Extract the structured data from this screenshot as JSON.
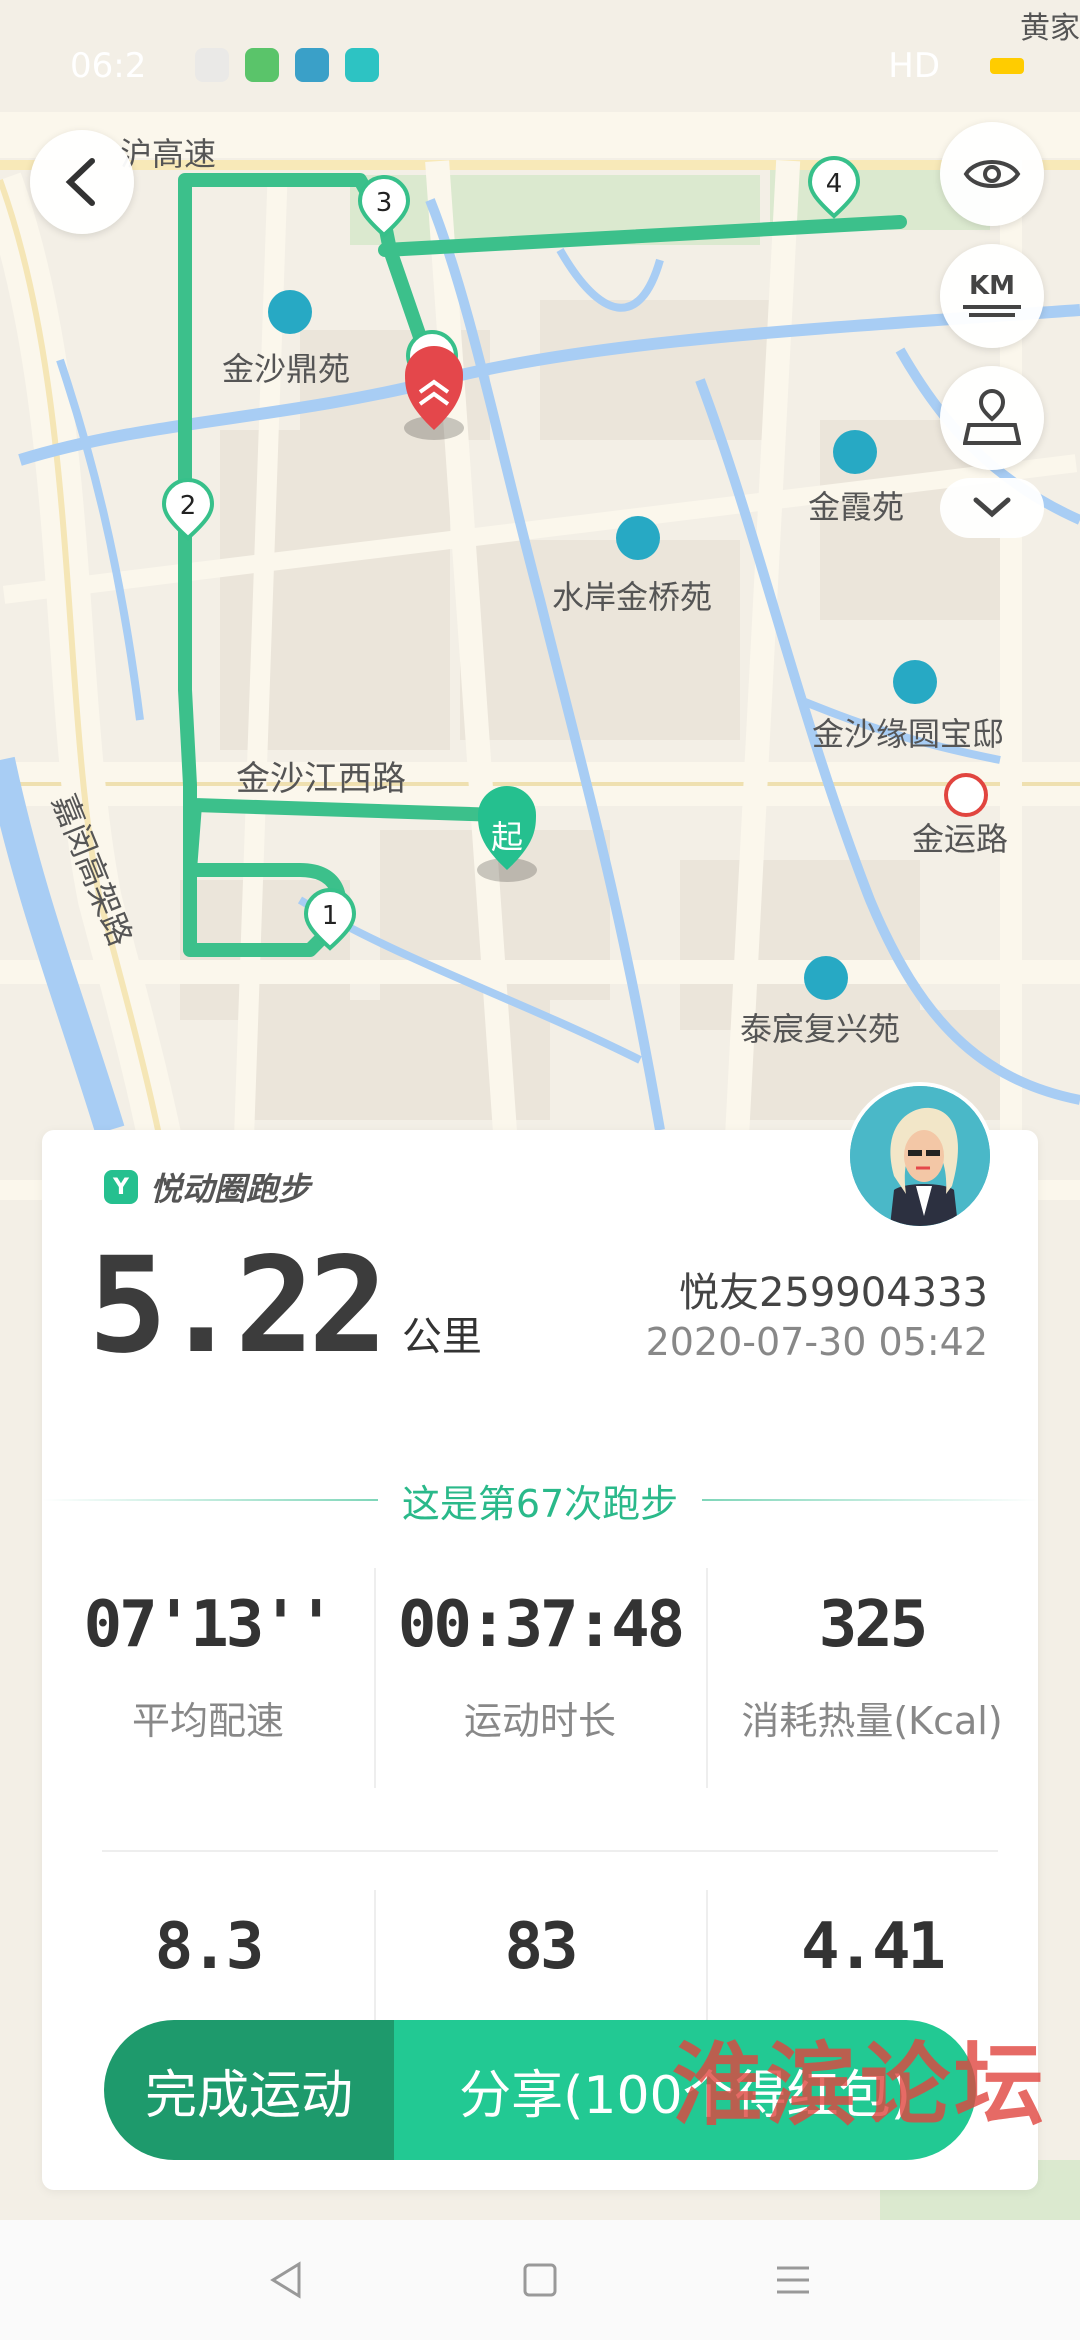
{
  "status_bar": {
    "time": "06:2",
    "network": "HD"
  },
  "map": {
    "labels": {
      "expressway": "沪高速",
      "jinsha_dingyuan": "金沙鼎苑",
      "jinxia_yuan": "金霞苑",
      "shuian_jinqiao": "水岸金桥苑",
      "jinsha_yuanyuan": "金沙缘圆宝邸",
      "jinsha_jiangxi_road": "金沙江西路",
      "jinyun_road": "金运路",
      "taichen_fuxing": "泰宸复兴苑",
      "jiamin_elevated": "嘉闵高架路",
      "top_right": "黄家"
    },
    "start_marker": "起",
    "waypoints": [
      "1",
      "2",
      "3",
      "4",
      "5"
    ],
    "route_color": "#37c08a",
    "km_button_label": "KM"
  },
  "card": {
    "brand": "悦动圈跑步",
    "distance_value": "5.22",
    "distance_unit": "公里",
    "user_name": "悦友259904333",
    "datetime": "2020-07-30 05:42",
    "run_count_text": "这是第67次跑步",
    "stats_row1": [
      {
        "value": "07'13''",
        "label": "平均配速"
      },
      {
        "value": "00:37:48",
        "label": "运动时长"
      },
      {
        "value": "325",
        "label": "消耗热量(Kcal)"
      }
    ],
    "stats_row2": [
      {
        "value": "8.3"
      },
      {
        "value": "83"
      },
      {
        "value": "4.41"
      }
    ]
  },
  "actions": {
    "finish_label": "完成运动",
    "share_label": "分享(100个得红包)"
  },
  "watermark": "淮滨论坛",
  "colors": {
    "accent": "#25c08f",
    "finish": "#1e9a6c",
    "share": "#22c993"
  }
}
